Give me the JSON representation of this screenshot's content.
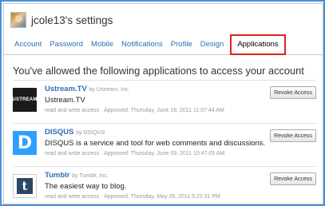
{
  "header": {
    "title": "jcole13's settings"
  },
  "tabs": [
    {
      "label": "Account"
    },
    {
      "label": "Password"
    },
    {
      "label": "Mobile"
    },
    {
      "label": "Notifications"
    },
    {
      "label": "Profile"
    },
    {
      "label": "Design"
    },
    {
      "label": "Applications",
      "active": true
    }
  ],
  "main": {
    "heading": "You've allowed the following applications to access your account",
    "revoke_label": "Revoke Access",
    "apps": [
      {
        "name": "Ustream.TV",
        "by": "by Ustream, Inc.",
        "description": "Ustream.TV",
        "access": "read and write access",
        "approved": "Approved: Thursday, June 16, 2011 11:07:44 AM",
        "logo_text": "USTREAM",
        "logo_icon": "ustream-logo-icon"
      },
      {
        "name": "DISQUS",
        "by": "by DISQUS",
        "description": "DISQUS is a service and tool for web comments and discussions.",
        "access": "read and write access",
        "approved": "Approved: Thursday, June 09, 2011 10:47:05 AM",
        "logo_text": "D",
        "logo_icon": "disqus-logo-icon"
      },
      {
        "name": "Tumblr",
        "by": "by Tumblr, Inc.",
        "description": "The easiest way to blog.",
        "access": "read and write access",
        "approved": "Approved: Thursday, May 26, 2011 5:22:31 PM",
        "logo_text": "t",
        "logo_icon": "tumblr-logo-icon"
      }
    ]
  },
  "colors": {
    "link": "#2f6fb2",
    "active_tab_highlight": "#d9261c",
    "frame": "#4a90d9"
  }
}
